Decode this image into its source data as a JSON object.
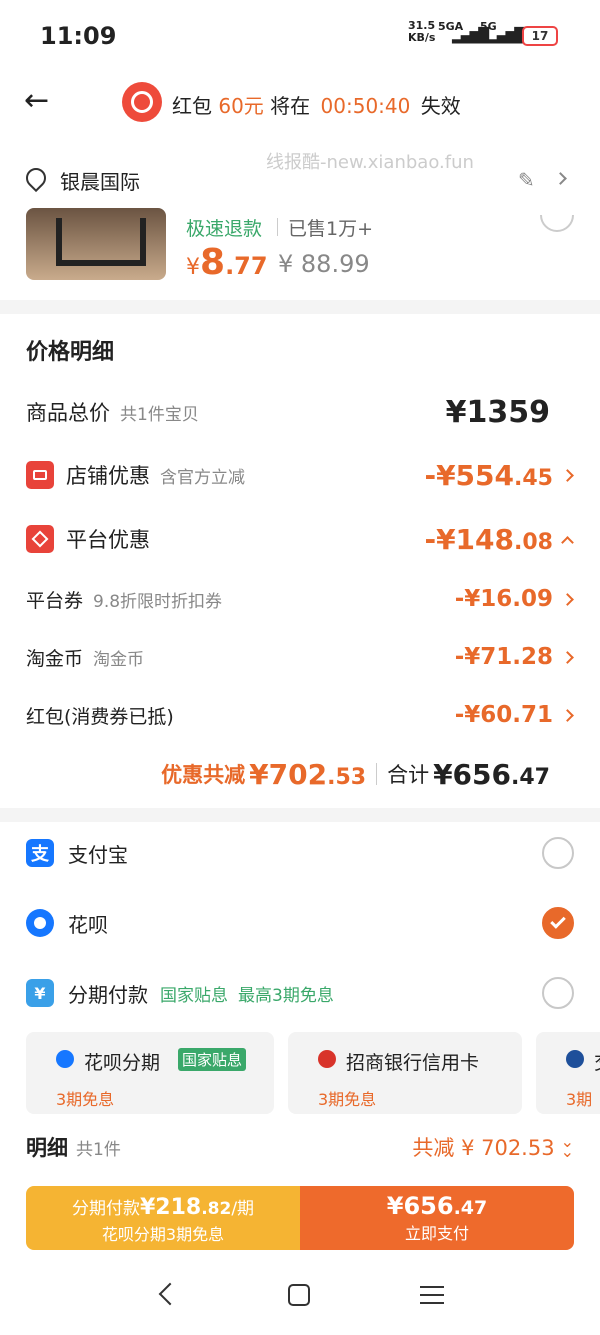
{
  "status_bar": {
    "time": "11:09",
    "speed_top": "31.5",
    "speed_unit": "KB/s",
    "net1": "5GA",
    "net2": "5G",
    "battery": "17"
  },
  "header": {
    "prefix": "红包",
    "amount": "60元",
    "mid": "将在",
    "countdown": "00:50:40",
    "suffix": "失效"
  },
  "address": {
    "name": "银晨国际",
    "watermark": "线报酷-new.xianbao.fun"
  },
  "product": {
    "tag1": "极速退款",
    "tag2": "已售1万+",
    "price_int": "8",
    "price_dec": ".77",
    "original": "¥ 88.99",
    "currency": "¥"
  },
  "detail": {
    "title": "价格明细",
    "total_label": "商品总价",
    "total_sub": "共1件宝贝",
    "total_value": "¥1359",
    "shop_label": "店铺优惠",
    "shop_sub": "含官方立减",
    "shop_value_main": "-¥554",
    "shop_value_dec": ".45",
    "platform_label": "平台优惠",
    "platform_value_main": "-¥148",
    "platform_value_dec": ".08",
    "coupon_label": "平台券",
    "coupon_sub": "9.8折限时折扣券",
    "coupon_value": "-¥16.09",
    "coin_label": "淘金币",
    "coin_sub": "淘金币",
    "coin_value": "-¥71.28",
    "redpack_label": "红包(消费券已抵)",
    "redpack_value": "-¥60.71",
    "discount_label": "优惠共减",
    "discount_main": "¥702",
    "discount_dec": ".53",
    "sum_label": "合计",
    "sum_main": "¥656",
    "sum_dec": ".47"
  },
  "payment": {
    "alipay": "支付宝",
    "huabei": "花呗",
    "installment": "分期付款",
    "installment_tag": "国家贴息",
    "installment_note": "最高3期免息",
    "cards": [
      {
        "title": "花呗分期",
        "badge": "国家贴息",
        "sub": "3期免息"
      },
      {
        "title": "招商银行信用卡",
        "sub": "3期免息"
      },
      {
        "title": "交",
        "sub": "3期"
      }
    ]
  },
  "summary": {
    "label": "明细",
    "count": "共1件",
    "reduce": "共减 ¥ 702.53"
  },
  "footer": {
    "left_prefix": "分期付款",
    "left_amount_main": "¥218",
    "left_amount_dec": ".82",
    "left_per": "/期",
    "left_sub": "花呗分期3期免息",
    "right_amount_main": "¥656",
    "right_amount_dec": ".47",
    "right_sub": "立即支付"
  },
  "colors": {
    "accent": "#e8692a",
    "green": "#3aa86a",
    "yellow": "#f5b433"
  }
}
